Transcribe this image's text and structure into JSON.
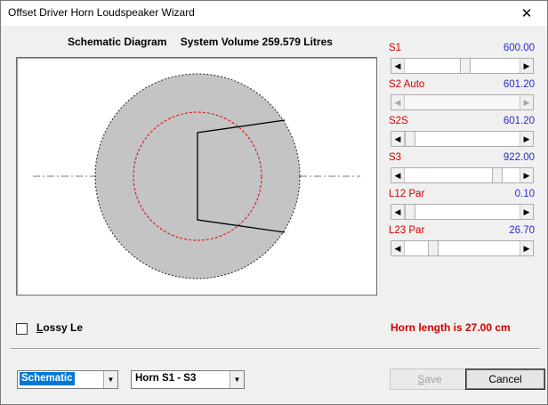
{
  "window": {
    "title": "Offset Driver Horn Loudspeaker Wizard",
    "close_glyph": "✕"
  },
  "diagram": {
    "label": "Schematic Diagram",
    "volume_text": "System Volume 259.579 Litres"
  },
  "params": [
    {
      "name": "S1",
      "value": "600.00",
      "level": 0.52,
      "disabled": false
    },
    {
      "name": "S2  Auto",
      "value": "601.20",
      "level": 0.0,
      "disabled": true
    },
    {
      "name": "S2S",
      "value": "601.20",
      "level": 0.0,
      "disabled": false
    },
    {
      "name": "S3",
      "value": "922.00",
      "level": 0.82,
      "disabled": false
    },
    {
      "name": "L12  Par",
      "value": "0.10",
      "level": 0.0,
      "disabled": false
    },
    {
      "name": "L23  Par",
      "value": "26.70",
      "level": 0.22,
      "disabled": false
    }
  ],
  "lossy": {
    "label": "Lossy Le",
    "checked": false
  },
  "horn_length_text": "Horn length is 27.00 cm",
  "view_select": {
    "value": "Schematic"
  },
  "section_select": {
    "value": "Horn S1 - S3"
  },
  "buttons": {
    "save_label_first": "S",
    "save_label_rest": "ave",
    "cancel_label": "Cancel"
  },
  "colors": {
    "param_name": "#d00000",
    "param_value": "#2a2acf",
    "accent": "#0078d7"
  }
}
